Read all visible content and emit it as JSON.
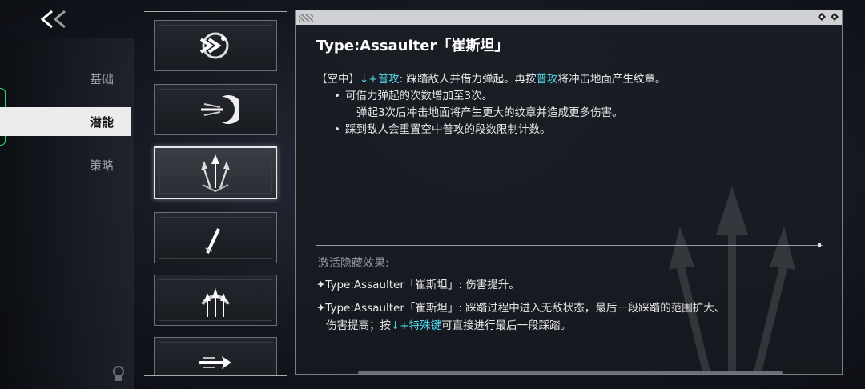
{
  "nav": {
    "back_label": "<<",
    "tabs": [
      {
        "label": "基础",
        "active": false
      },
      {
        "label": "潜能",
        "active": true
      },
      {
        "label": "策略",
        "active": false
      }
    ]
  },
  "skills": [
    {
      "icon": "dash-chevron-icon",
      "selected": false
    },
    {
      "icon": "crescent-slash-icon",
      "selected": false
    },
    {
      "icon": "triple-arrow-icon",
      "selected": true
    },
    {
      "icon": "blade-arc-icon",
      "selected": false
    },
    {
      "icon": "arrow-burst-icon",
      "selected": false
    },
    {
      "icon": "swift-arrow-icon",
      "selected": false
    }
  ],
  "detail": {
    "title": "Type:Assaulter「崔斯坦」",
    "line1_prefix": "【空中】",
    "line1_input": "↓+普攻",
    "line1_mid": ": 踩踏敌人并借力弹起。再按",
    "line1_input2": "普攻",
    "line1_suffix": "将冲击地面产生纹章。",
    "bullet1": "可借力弹起的次数增加至3次。",
    "bullet1_cont": "弹起3次后冲击地面将产生更大的纹章并造成更多伤害。",
    "bullet2": "踩到敌人会重置空中普攻的段数限制计数。",
    "bullet_symbol": "•",
    "hidden_title": "激活隐藏效果:",
    "hidden1": "✦Type:Assaulter「崔斯坦」: 伤害提升。",
    "hidden2_a": "✦Type:Assaulter「崔斯坦」: 踩踏过程中进入无敌状态，最后一段踩踏的范围扩大、",
    "hidden2_b_prefix": "伤害提高；按",
    "hidden2_b_input": "↓+特殊键",
    "hidden2_b_suffix": "可直接进行最后一段踩踏。"
  },
  "colors": {
    "accent_cyan": "#4fd6ea",
    "accent_green": "#38d16a"
  }
}
